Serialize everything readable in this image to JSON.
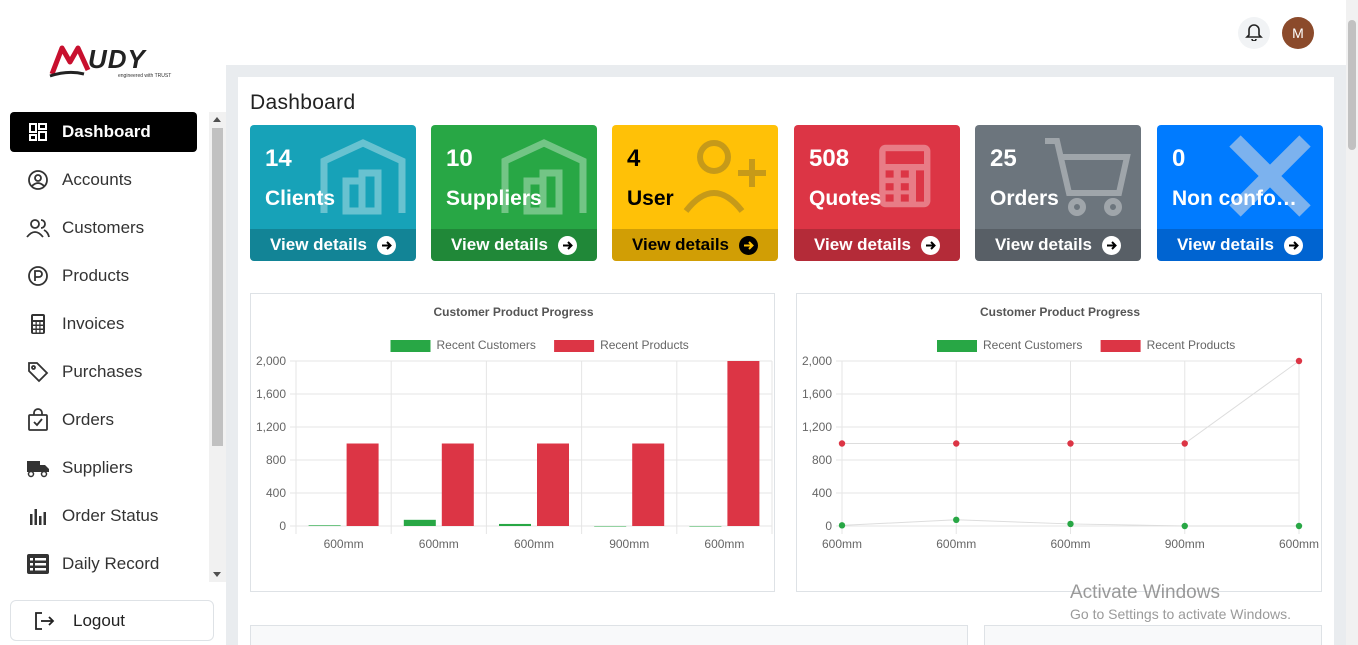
{
  "brand": {
    "logo_text": "MUDY",
    "tagline": "engineered with TRUST"
  },
  "sidebar": {
    "items": [
      {
        "label": "Dashboard",
        "icon": "dashboard-icon",
        "active": true
      },
      {
        "label": "Accounts",
        "icon": "user-circle-icon"
      },
      {
        "label": "Customers",
        "icon": "users-icon"
      },
      {
        "label": "Products",
        "icon": "p-circle-icon"
      },
      {
        "label": "Invoices",
        "icon": "calculator-icon"
      },
      {
        "label": "Purchases",
        "icon": "tag-icon"
      },
      {
        "label": "Orders",
        "icon": "bag-check-icon"
      },
      {
        "label": "Suppliers",
        "icon": "truck-icon"
      },
      {
        "label": "Order Status",
        "icon": "bar-chart-icon"
      },
      {
        "label": "Daily Record",
        "icon": "list-icon"
      }
    ],
    "logout_label": "Logout"
  },
  "header": {
    "avatar_initial": "M"
  },
  "page": {
    "title": "Dashboard"
  },
  "cards": [
    {
      "value": "14",
      "label": "Clients",
      "footer": "View details",
      "color": "#17a2b8",
      "icon": "warehouse-icon"
    },
    {
      "value": "10",
      "label": "Suppliers",
      "footer": "View details",
      "color": "#28a745",
      "icon": "warehouse-icon"
    },
    {
      "value": "4",
      "label": "User",
      "footer": "View details",
      "color": "#ffc107",
      "icon": "user-plus-icon"
    },
    {
      "value": "508",
      "label": "Quotes",
      "footer": "View details",
      "color": "#dc3545",
      "icon": "calculator-icon"
    },
    {
      "value": "25",
      "label": "Orders",
      "footer": "View details",
      "color": "#6c757d",
      "icon": "cart-icon"
    },
    {
      "value": "0",
      "label": "Non conformities",
      "footer": "View details",
      "color": "#007bff",
      "icon": "x-icon"
    }
  ],
  "chart_data": [
    {
      "type": "bar",
      "title": "Customer Product Progress",
      "categories": [
        "600mm",
        "600mm",
        "600mm",
        "900mm",
        "600mm"
      ],
      "series": [
        {
          "name": "Recent Customers",
          "color": "#28a745",
          "values": [
            8,
            75,
            25,
            0,
            0
          ]
        },
        {
          "name": "Recent Products",
          "color": "#dc3545",
          "values": [
            1000,
            1000,
            1000,
            1000,
            2000
          ]
        }
      ],
      "ylim": [
        0,
        2000
      ],
      "yticks": [
        "0",
        "400",
        "800",
        "1,200",
        "1,600",
        "2,000"
      ],
      "legend": "top",
      "grid": true
    },
    {
      "type": "line",
      "title": "Customer Product Progress",
      "categories": [
        "600mm",
        "600mm",
        "600mm",
        "900mm",
        "600mm"
      ],
      "series": [
        {
          "name": "Recent Customers",
          "color": "#28a745",
          "values": [
            8,
            75,
            25,
            0,
            0
          ]
        },
        {
          "name": "Recent Products",
          "color": "#dc3545",
          "values": [
            1000,
            1000,
            1000,
            1000,
            2000
          ]
        }
      ],
      "ylim": [
        0,
        2000
      ],
      "yticks": [
        "0",
        "400",
        "800",
        "1,200",
        "1,600",
        "2,000"
      ],
      "legend": "top",
      "grid": true
    }
  ],
  "watermark": {
    "line1": "Activate Windows",
    "line2": "Go to Settings to activate Windows."
  }
}
